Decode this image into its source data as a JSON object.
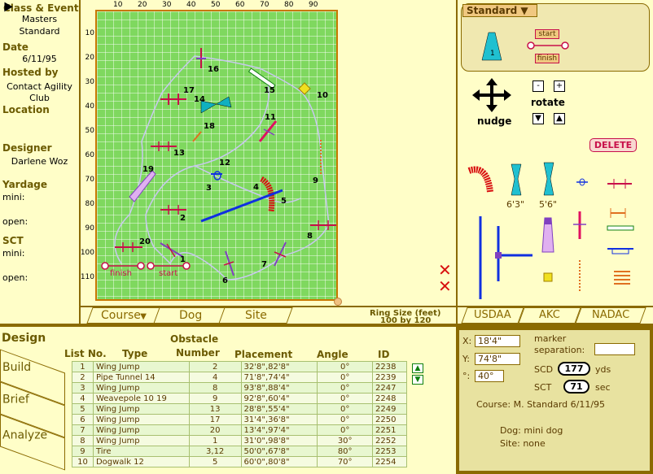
{
  "left_panel": {
    "class_label": "Class & Event",
    "class_value_1": "Masters",
    "class_value_2": "Standard",
    "date_label": "Date",
    "date_value": "6/11/95",
    "hosted_label": "Hosted by",
    "hosted_value_1": "Contact Agility",
    "hosted_value_2": "Club",
    "location_label": "Location",
    "designer_label": "Designer",
    "designer_value": "Darlene Woz",
    "yardage_label": "Yardage",
    "yardage_mini": "mini:",
    "yardage_open": "open:",
    "sct_label": "SCT",
    "sct_mini": "mini:",
    "sct_open": "open:"
  },
  "ruler": {
    "x_ticks": [
      "10",
      "20",
      "30",
      "40",
      "50",
      "60",
      "70",
      "80",
      "90"
    ],
    "y_ticks": [
      "10",
      "20",
      "30",
      "40",
      "50",
      "60",
      "70",
      "80",
      "90",
      "100",
      "110"
    ]
  },
  "course_numbers": [
    "1",
    "2",
    "3",
    "4",
    "5",
    "6",
    "7",
    "8",
    "9",
    "10",
    "11",
    "12",
    "13",
    "14",
    "15",
    "16",
    "17",
    "18",
    "19",
    "20"
  ],
  "course_labels": {
    "start": "start",
    "finish": "finish"
  },
  "course_tabs": [
    "Course",
    "Dog",
    "Site"
  ],
  "ring_size_label": "Ring Size (feet)",
  "ring_size_value": "100 by 120",
  "palette": {
    "standard_menu": "Standard",
    "start_label": "start",
    "finish_label": "finish",
    "nudge_label": "nudge",
    "rotate_label": "rotate",
    "minus": "-",
    "plus": "+",
    "delete_label": "DELETE",
    "tire_63": "6'3\"",
    "tire_56": "5'6\"",
    "orgs": [
      "USDAA",
      "AKC",
      "NADAC"
    ]
  },
  "side_tabs": [
    "Design",
    "Build",
    "Brief",
    "Analyze"
  ],
  "table": {
    "header_obstacle": "Obstacle",
    "header_list_no": "List No.",
    "header_type": "Type",
    "header_number": "Number",
    "header_placement": "Placement",
    "header_angle": "Angle",
    "header_id": "ID",
    "rows": [
      [
        "1",
        "Wing Jump",
        "2",
        "32'8\",82'8\"",
        "0°",
        "2238"
      ],
      [
        "2",
        "Pipe Tunnel 14",
        "4",
        "71'8\",74'4\"",
        "0°",
        "2239"
      ],
      [
        "3",
        "Wing Jump",
        "8",
        "93'8\",88'4\"",
        "0°",
        "2247"
      ],
      [
        "4",
        "Weavepole 10 19",
        "9",
        "92'8\",60'4\"",
        "0°",
        "2248"
      ],
      [
        "5",
        "Wing Jump",
        "13",
        "28'8\",55'4\"",
        "0°",
        "2249"
      ],
      [
        "6",
        "Wing Jump",
        "17",
        "31'4\",36'8\"",
        "0°",
        "2250"
      ],
      [
        "7",
        "Wing Jump",
        "20",
        "13'4\",97'4\"",
        "0°",
        "2251"
      ],
      [
        "8",
        "Wing Jump",
        "1",
        "31'0\",98'8\"",
        "30°",
        "2252"
      ],
      [
        "9",
        "Tire",
        "3,12",
        "50'0\",67'8\"",
        "80°",
        "2253"
      ],
      [
        "10",
        "Dogwalk 12",
        "5",
        "60'0\",80'8\"",
        "70°",
        "2254"
      ]
    ]
  },
  "info": {
    "x_label": "X:",
    "x_value": "18'4\"",
    "y_label": "Y:",
    "y_value": "74'8\"",
    "angle_label": "°:",
    "angle_value": "40°",
    "marker_label_1": "marker",
    "marker_label_2": "separation:",
    "scd_label": "SCD",
    "scd_value": "177",
    "scd_unit": "yds",
    "sct_label": "SCT",
    "sct_value": "71",
    "sct_unit": "sec",
    "course_line": "Course:  M. Standard 6/11/95",
    "dog_line": "Dog:  mini dog",
    "site_line": "Site:  none"
  },
  "colors": {
    "ring": "#7fd85f",
    "accent": "#8a6a00",
    "jump": "#c8104a",
    "tunnel": "#d81010",
    "dogwalk": "#1030e0",
    "weave": "#e07020"
  }
}
